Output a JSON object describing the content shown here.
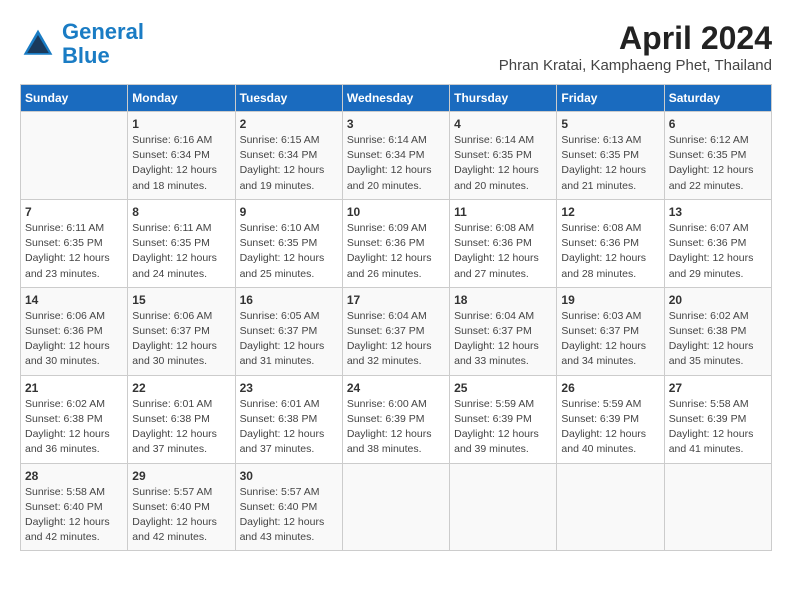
{
  "header": {
    "logo_line1": "General",
    "logo_line2": "Blue",
    "title": "April 2024",
    "subtitle": "Phran Kratai, Kamphaeng Phet, Thailand"
  },
  "calendar": {
    "days_of_week": [
      "Sunday",
      "Monday",
      "Tuesday",
      "Wednesday",
      "Thursday",
      "Friday",
      "Saturday"
    ],
    "weeks": [
      [
        {
          "day": "",
          "content": ""
        },
        {
          "day": "1",
          "content": "Sunrise: 6:16 AM\nSunset: 6:34 PM\nDaylight: 12 hours\nand 18 minutes."
        },
        {
          "day": "2",
          "content": "Sunrise: 6:15 AM\nSunset: 6:34 PM\nDaylight: 12 hours\nand 19 minutes."
        },
        {
          "day": "3",
          "content": "Sunrise: 6:14 AM\nSunset: 6:34 PM\nDaylight: 12 hours\nand 20 minutes."
        },
        {
          "day": "4",
          "content": "Sunrise: 6:14 AM\nSunset: 6:35 PM\nDaylight: 12 hours\nand 20 minutes."
        },
        {
          "day": "5",
          "content": "Sunrise: 6:13 AM\nSunset: 6:35 PM\nDaylight: 12 hours\nand 21 minutes."
        },
        {
          "day": "6",
          "content": "Sunrise: 6:12 AM\nSunset: 6:35 PM\nDaylight: 12 hours\nand 22 minutes."
        }
      ],
      [
        {
          "day": "7",
          "content": "Sunrise: 6:11 AM\nSunset: 6:35 PM\nDaylight: 12 hours\nand 23 minutes."
        },
        {
          "day": "8",
          "content": "Sunrise: 6:11 AM\nSunset: 6:35 PM\nDaylight: 12 hours\nand 24 minutes."
        },
        {
          "day": "9",
          "content": "Sunrise: 6:10 AM\nSunset: 6:35 PM\nDaylight: 12 hours\nand 25 minutes."
        },
        {
          "day": "10",
          "content": "Sunrise: 6:09 AM\nSunset: 6:36 PM\nDaylight: 12 hours\nand 26 minutes."
        },
        {
          "day": "11",
          "content": "Sunrise: 6:08 AM\nSunset: 6:36 PM\nDaylight: 12 hours\nand 27 minutes."
        },
        {
          "day": "12",
          "content": "Sunrise: 6:08 AM\nSunset: 6:36 PM\nDaylight: 12 hours\nand 28 minutes."
        },
        {
          "day": "13",
          "content": "Sunrise: 6:07 AM\nSunset: 6:36 PM\nDaylight: 12 hours\nand 29 minutes."
        }
      ],
      [
        {
          "day": "14",
          "content": "Sunrise: 6:06 AM\nSunset: 6:36 PM\nDaylight: 12 hours\nand 30 minutes."
        },
        {
          "day": "15",
          "content": "Sunrise: 6:06 AM\nSunset: 6:37 PM\nDaylight: 12 hours\nand 30 minutes."
        },
        {
          "day": "16",
          "content": "Sunrise: 6:05 AM\nSunset: 6:37 PM\nDaylight: 12 hours\nand 31 minutes."
        },
        {
          "day": "17",
          "content": "Sunrise: 6:04 AM\nSunset: 6:37 PM\nDaylight: 12 hours\nand 32 minutes."
        },
        {
          "day": "18",
          "content": "Sunrise: 6:04 AM\nSunset: 6:37 PM\nDaylight: 12 hours\nand 33 minutes."
        },
        {
          "day": "19",
          "content": "Sunrise: 6:03 AM\nSunset: 6:37 PM\nDaylight: 12 hours\nand 34 minutes."
        },
        {
          "day": "20",
          "content": "Sunrise: 6:02 AM\nSunset: 6:38 PM\nDaylight: 12 hours\nand 35 minutes."
        }
      ],
      [
        {
          "day": "21",
          "content": "Sunrise: 6:02 AM\nSunset: 6:38 PM\nDaylight: 12 hours\nand 36 minutes."
        },
        {
          "day": "22",
          "content": "Sunrise: 6:01 AM\nSunset: 6:38 PM\nDaylight: 12 hours\nand 37 minutes."
        },
        {
          "day": "23",
          "content": "Sunrise: 6:01 AM\nSunset: 6:38 PM\nDaylight: 12 hours\nand 37 minutes."
        },
        {
          "day": "24",
          "content": "Sunrise: 6:00 AM\nSunset: 6:39 PM\nDaylight: 12 hours\nand 38 minutes."
        },
        {
          "day": "25",
          "content": "Sunrise: 5:59 AM\nSunset: 6:39 PM\nDaylight: 12 hours\nand 39 minutes."
        },
        {
          "day": "26",
          "content": "Sunrise: 5:59 AM\nSunset: 6:39 PM\nDaylight: 12 hours\nand 40 minutes."
        },
        {
          "day": "27",
          "content": "Sunrise: 5:58 AM\nSunset: 6:39 PM\nDaylight: 12 hours\nand 41 minutes."
        }
      ],
      [
        {
          "day": "28",
          "content": "Sunrise: 5:58 AM\nSunset: 6:40 PM\nDaylight: 12 hours\nand 42 minutes."
        },
        {
          "day": "29",
          "content": "Sunrise: 5:57 AM\nSunset: 6:40 PM\nDaylight: 12 hours\nand 42 minutes."
        },
        {
          "day": "30",
          "content": "Sunrise: 5:57 AM\nSunset: 6:40 PM\nDaylight: 12 hours\nand 43 minutes."
        },
        {
          "day": "",
          "content": ""
        },
        {
          "day": "",
          "content": ""
        },
        {
          "day": "",
          "content": ""
        },
        {
          "day": "",
          "content": ""
        }
      ]
    ]
  }
}
